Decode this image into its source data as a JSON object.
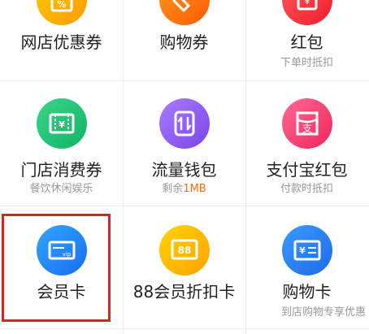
{
  "items": [
    {
      "label": "网店优惠券",
      "sub": "",
      "icon": "percent-coupon-icon",
      "color": "#ffb400"
    },
    {
      "label": "购物券",
      "sub": "",
      "icon": "shopping-voucher-icon",
      "color": "#ff6a00"
    },
    {
      "label": "红包",
      "sub": "下单时抵扣",
      "icon": "red-packet-icon",
      "color": "#ff3a3a"
    },
    {
      "label": "门店消费券",
      "sub": "餐饮休闲娱乐",
      "icon": "store-coupon-icon",
      "color": "#22c074"
    },
    {
      "label": "流量钱包",
      "sub_prefix": "剩余",
      "sub_value": "1MB",
      "icon": "data-wallet-icon",
      "color": "#8a5cf0"
    },
    {
      "label": "支付宝红包",
      "sub": "付款时抵扣",
      "icon": "alipay-red-packet-icon",
      "color": "#ff3f78"
    },
    {
      "label": "会员卡",
      "sub": "",
      "icon": "vip-card-icon",
      "color": "#2a7df0"
    },
    {
      "label": "88会员折扣卡",
      "sub": "",
      "icon": "88-card-icon",
      "color": "#ffb400"
    },
    {
      "label": "购物卡",
      "sub": "到店购物专享优惠",
      "icon": "shopping-card-icon",
      "color": "#2a7df0"
    }
  ],
  "highlight": {
    "item": "会员卡",
    "color": "#e02020"
  }
}
